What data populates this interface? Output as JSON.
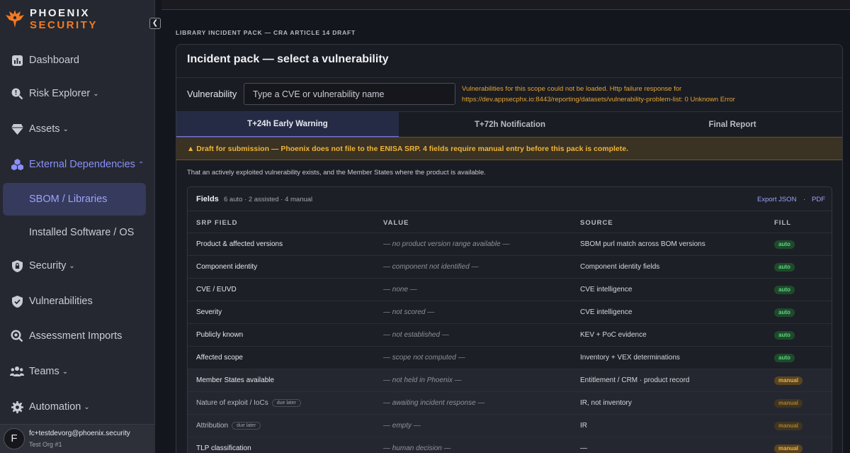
{
  "brand": {
    "line1": "PHOENIX",
    "line2": "SECURITY"
  },
  "sidebar": {
    "collapse_glyph": "❮",
    "items": [
      {
        "label": "Dashboard",
        "icon": "bar-chart-icon",
        "chevron": ""
      },
      {
        "label": "Risk Explorer",
        "icon": "risk-search-icon",
        "chevron": "⌄"
      },
      {
        "label": "Assets",
        "icon": "diamond-icon",
        "chevron": "⌄"
      },
      {
        "label": "External Dependencies",
        "icon": "cubes-icon",
        "chevron": "⌃"
      },
      {
        "label": "Security",
        "icon": "lock-shield-icon",
        "chevron": "⌄"
      },
      {
        "label": "Vulnerabilities",
        "icon": "shield-check-icon",
        "chevron": ""
      },
      {
        "label": "Assessment Imports",
        "icon": "search-icon",
        "chevron": ""
      },
      {
        "label": "Teams",
        "icon": "people-icon",
        "chevron": "⌄"
      },
      {
        "label": "Automation",
        "icon": "gear-icon",
        "chevron": "⌄"
      }
    ],
    "sub_items": [
      {
        "label": "SBOM / Libraries",
        "selected": true
      },
      {
        "label": "Installed Software / OS",
        "selected": false
      }
    ],
    "user": {
      "initial": "F",
      "email": "fc+testdevorg@phoenix.security",
      "org": "Test Org #1"
    }
  },
  "page": {
    "kicker": "LIBRARY INCIDENT PACK — CRA ARTICLE 14 DRAFT",
    "title": "Incident pack — select a vulnerability",
    "vuln_label": "Vulnerability",
    "vuln_placeholder": "Type a CVE or vulnerability name",
    "error_line1": "Vulnerabilities for this scope could not be loaded. Http failure response for",
    "error_line2": "https://dev.appsecphx.io:8443/reporting/datasets/vulnerability-problem-list: 0 Unknown Error",
    "tabs": [
      "T+24h Early Warning",
      "T+72h Notification",
      "Final Report"
    ],
    "active_tab": 0,
    "banner": "▲ Draft for submission — Phoenix does not file to the ENISA SRP. 4 fields require manual entry before this pack is complete.",
    "description": "That an actively exploited vulnerability exists, and the Member States where the product is available."
  },
  "fields": {
    "title": "Fields",
    "meta": "6 auto · 2 assisted · 4 manual",
    "export_json": "Export JSON",
    "separator": "·",
    "pdf": "PDF",
    "columns": [
      "SRP FIELD",
      "VALUE",
      "SOURCE",
      "FILL"
    ],
    "rows": [
      {
        "field": "Product & affected versions",
        "tag": "",
        "value": "— no product version range available —",
        "source": "SBOM purl match across BOM versions",
        "fill": "auto"
      },
      {
        "field": "Component identity",
        "tag": "",
        "value": "— component not identified —",
        "source": "Component identity fields",
        "fill": "auto"
      },
      {
        "field": "CVE / EUVD",
        "tag": "",
        "value": "— none —",
        "source": "CVE intelligence",
        "fill": "auto"
      },
      {
        "field": "Severity",
        "tag": "",
        "value": "— not scored —",
        "source": "CVE intelligence",
        "fill": "auto"
      },
      {
        "field": "Publicly known",
        "tag": "",
        "value": "— not established —",
        "source": "KEV + PoC evidence",
        "fill": "auto"
      },
      {
        "field": "Affected scope",
        "tag": "",
        "value": "— scope not computed —",
        "source": "Inventory + VEX determinations",
        "fill": "auto"
      },
      {
        "field": "Member States available",
        "tag": "",
        "value": "— not held in Phoenix —",
        "source": "Entitlement / CRM · product record",
        "fill": "manual"
      },
      {
        "field": "Nature of exploit / IoCs",
        "tag": "due later",
        "value": "— awaiting incident response —",
        "source": "IR, not inventory",
        "fill": "manual"
      },
      {
        "field": "Attribution",
        "tag": "due later",
        "value": "— empty —",
        "source": "IR",
        "fill": "manual"
      },
      {
        "field": "TLP classification",
        "tag": "",
        "value": "— human decision —",
        "source": "—",
        "fill": "manual"
      }
    ]
  }
}
